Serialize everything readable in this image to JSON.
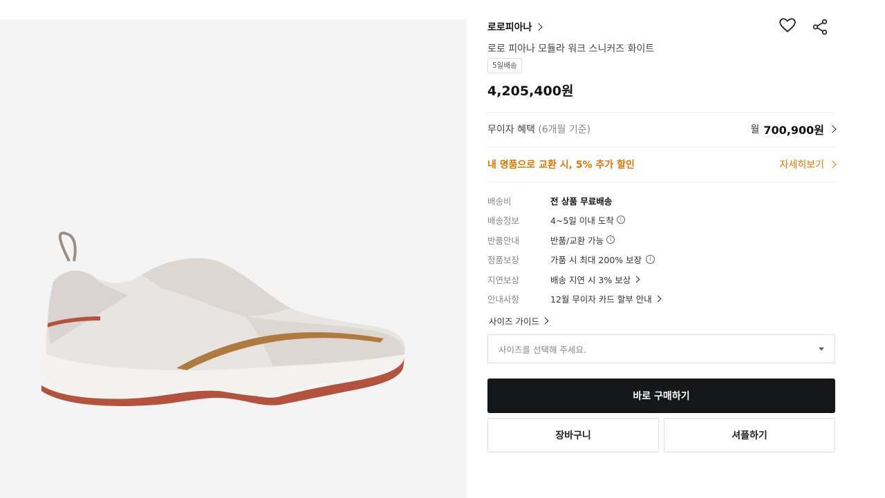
{
  "product": {
    "brand": "로로피아나",
    "name": "로로 피아나 모듈라 워크 스니커즈 화이트",
    "shipping_badge": "5일배송",
    "price": "4,205,400원"
  },
  "installment": {
    "label": "무이자 혜택",
    "period": "(6개월 기준)",
    "prefix": "월",
    "amount": "700,900원"
  },
  "promo": {
    "text": "내 명품으로 교환 시, 5% 추가 할인",
    "link": "자세히보기"
  },
  "info_rows": [
    {
      "label": "배송비",
      "value": "전 상품 무료배송"
    },
    {
      "label": "배송정보",
      "value": "4~5일 이내 도착"
    },
    {
      "label": "반품안내",
      "value": "반품/교환 가능"
    },
    {
      "label": "정품보장",
      "value": "가품 시 최대 200% 보장"
    },
    {
      "label": "지연보상",
      "value": "배송 지연 시 3% 보상"
    },
    {
      "label": "안내사항",
      "value": "12월 무이자 카드 할부 안내"
    }
  ],
  "size": {
    "guide_label": "사이즈 가이드",
    "placeholder": "사이즈를 선택해 주세요."
  },
  "buttons": {
    "buy": "바로 구매하기",
    "cart": "장바구니",
    "sell": "셔플하기"
  },
  "colors": {
    "accent": "#e07800",
    "primary_button": "#151719",
    "image_bg": "#f4f4f5"
  },
  "icons": [
    "heart-icon",
    "share-icon",
    "info-icon",
    "chevron-right-icon",
    "caret-down-icon"
  ]
}
